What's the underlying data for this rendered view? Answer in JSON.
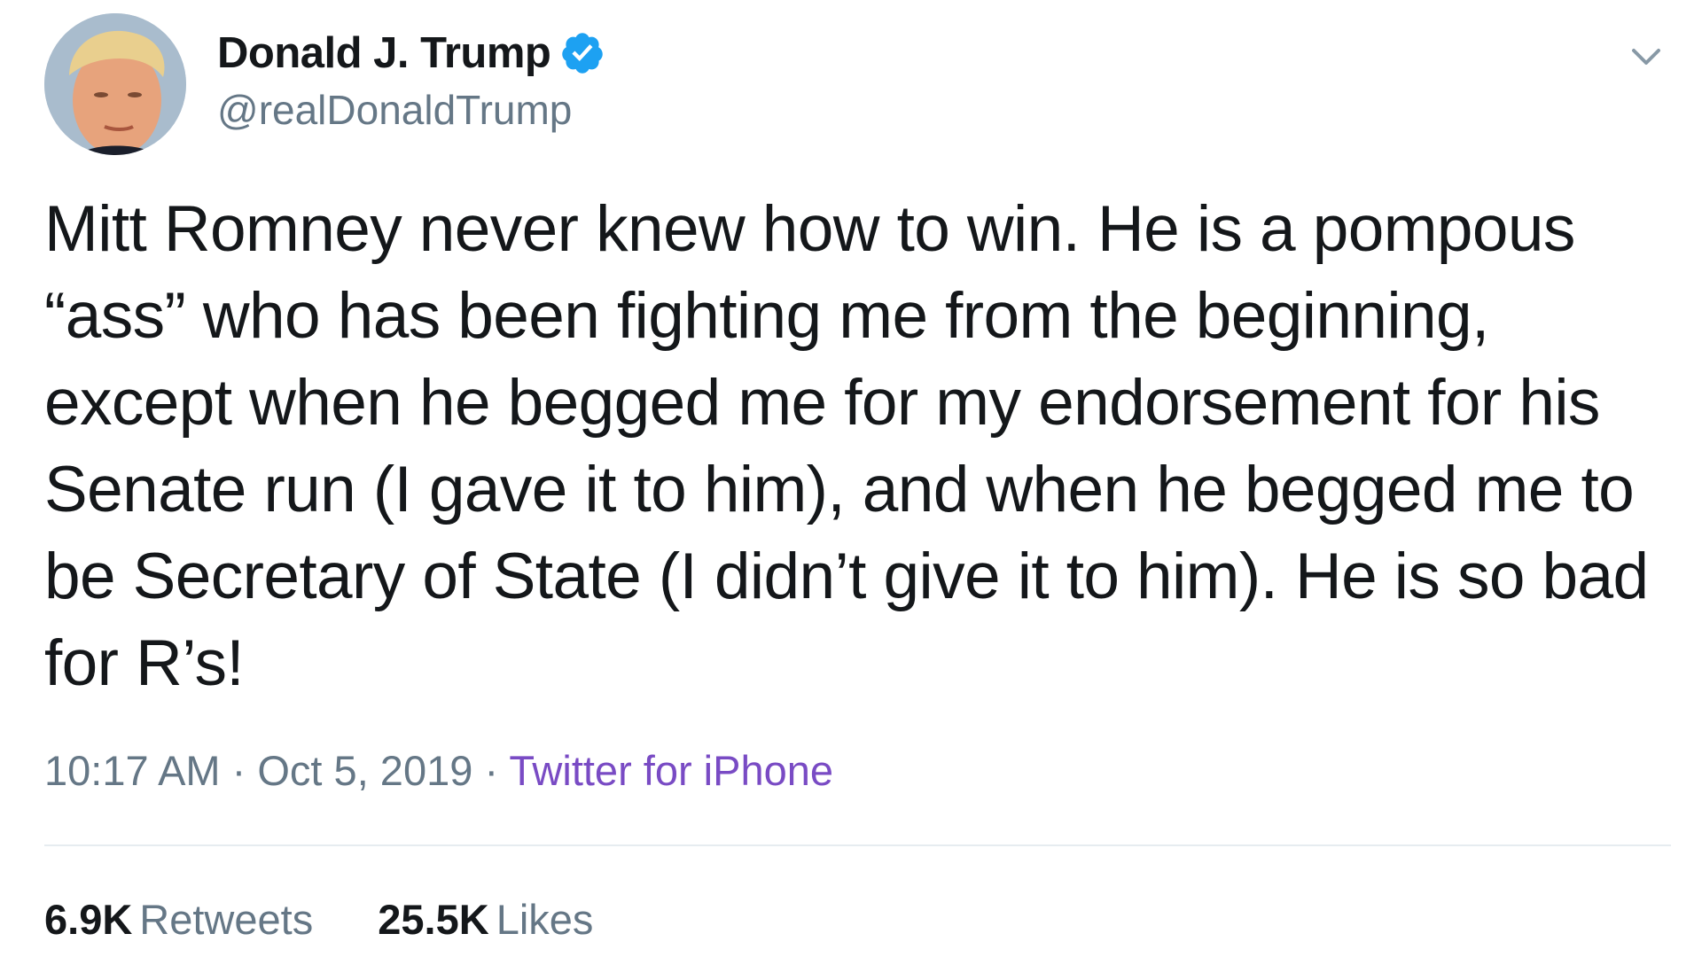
{
  "tweet": {
    "display_name": "Donald J. Trump",
    "handle": "@realDonaldTrump",
    "verified": true,
    "avatar_icon": "profile-photo",
    "menu_icon": "chevron-down-icon",
    "text": "Mitt Romney never knew how to win. He is a pompous “ass” who has been fighting me from the beginning, except when he begged me for my endorsement for his Senate run (I gave it to him), and when he begged me to be Secretary of State (I didn’t give it to him). He is so bad for R’s!",
    "time": "10:17 AM",
    "separator": "·",
    "date": "Oct 5, 2019",
    "source": "Twitter for iPhone",
    "retweets_count": "6.9K",
    "retweets_label": "Retweets",
    "likes_count": "25.5K",
    "likes_label": "Likes"
  },
  "colors": {
    "text": "#14171a",
    "secondary": "#657786",
    "verified_blue": "#1da1f2",
    "source_purple": "#794bc4",
    "divider": "#e6ecf0"
  }
}
